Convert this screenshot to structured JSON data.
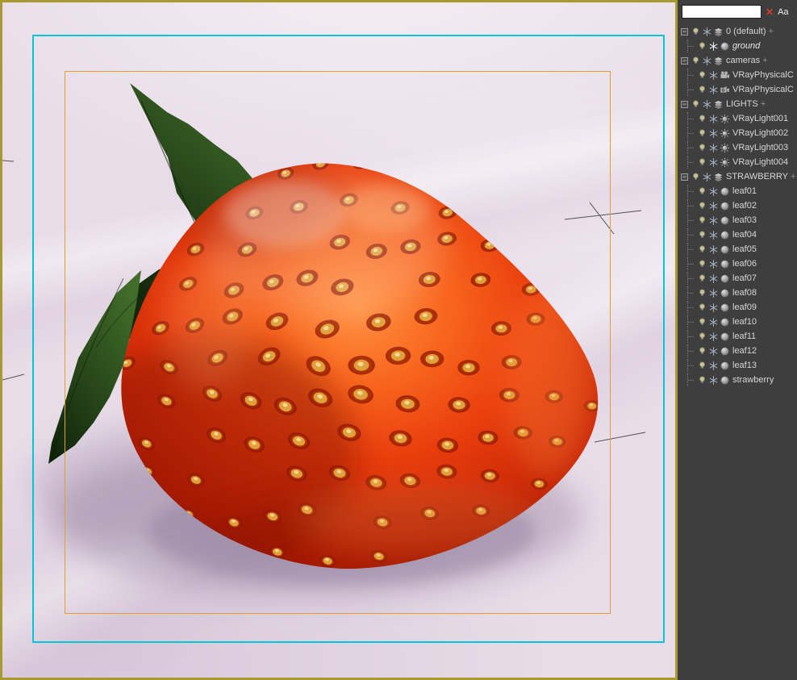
{
  "window": {
    "border_color": "#a89a2e"
  },
  "viewport": {
    "background_color": "#e8dce8",
    "safe_frame": {
      "outer_color": "#00c6da",
      "inner_color": "#dca12f"
    }
  },
  "explorer": {
    "background_color": "#3e3e3e",
    "search": {
      "value": "",
      "clear_label": "✕",
      "case_toggle_label": "Aa"
    },
    "collapse_glyph": "−",
    "icons": [
      "lightbulb-icon",
      "snowflake-icon",
      "layers-icon",
      "sphere-icon",
      "camera-icon",
      "light-icon"
    ],
    "rows": [
      {
        "label": "0 (default)",
        "kind": "layer",
        "depth": 0,
        "suffix": "+"
      },
      {
        "label": "ground",
        "kind": "geometry",
        "depth": 1,
        "italic": true,
        "frozen": true
      },
      {
        "label": "cameras",
        "kind": "layer",
        "depth": 0,
        "suffix": "+"
      },
      {
        "label": "VRayPhysicalC",
        "kind": "camera",
        "depth": 1
      },
      {
        "label": "VRayPhysicalC",
        "kind": "camera-body",
        "depth": 1
      },
      {
        "label": "LIGHTS",
        "kind": "layer",
        "depth": 0,
        "suffix": "+"
      },
      {
        "label": "VRayLight001",
        "kind": "light",
        "depth": 1
      },
      {
        "label": "VRayLight002",
        "kind": "light",
        "depth": 1
      },
      {
        "label": "VRayLight003",
        "kind": "light",
        "depth": 1
      },
      {
        "label": "VRayLight004",
        "kind": "light",
        "depth": 1
      },
      {
        "label": "STRAWBERRY",
        "kind": "layer",
        "depth": 0,
        "suffix": "+"
      },
      {
        "label": "leaf01",
        "kind": "geometry",
        "depth": 1
      },
      {
        "label": "leaf02",
        "kind": "geometry",
        "depth": 1
      },
      {
        "label": "leaf03",
        "kind": "geometry",
        "depth": 1
      },
      {
        "label": "leaf04",
        "kind": "geometry",
        "depth": 1
      },
      {
        "label": "leaf05",
        "kind": "geometry",
        "depth": 1
      },
      {
        "label": "leaf06",
        "kind": "geometry",
        "depth": 1
      },
      {
        "label": "leaf07",
        "kind": "geometry",
        "depth": 1
      },
      {
        "label": "leaf08",
        "kind": "geometry",
        "depth": 1
      },
      {
        "label": "leaf09",
        "kind": "geometry",
        "depth": 1
      },
      {
        "label": "leaf10",
        "kind": "geometry",
        "depth": 1
      },
      {
        "label": "leaf11",
        "kind": "geometry",
        "depth": 1
      },
      {
        "label": "leaf12",
        "kind": "geometry",
        "depth": 1
      },
      {
        "label": "leaf13",
        "kind": "geometry",
        "depth": 1
      },
      {
        "label": "strawberry",
        "kind": "geometry",
        "depth": 1
      }
    ]
  }
}
